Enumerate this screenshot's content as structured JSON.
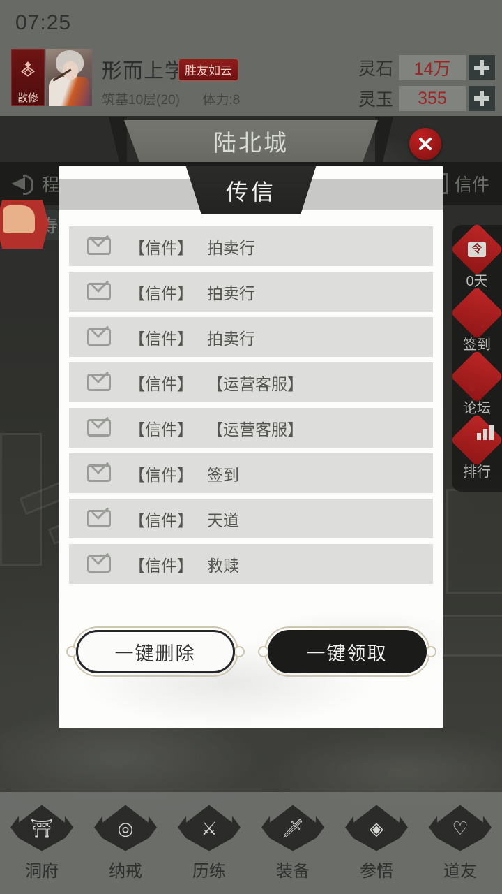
{
  "hud": {
    "clock": "07:25",
    "sect_name": "散修",
    "player_name": "形而上学",
    "guild_tag": "胜友如云",
    "realm": "筑基10层(20)",
    "stamina": "体力:8",
    "currencies": [
      {
        "label": "灵石",
        "value": "14万",
        "plus": "+"
      },
      {
        "label": "灵玉",
        "value": "355",
        "plus": "+"
      }
    ]
  },
  "city": {
    "title": "陆北城",
    "close_label": "×"
  },
  "background": {
    "toolbar_left_label": "程",
    "toolbar_right_label": "信件",
    "lifespan_label": "剩余寿元"
  },
  "side_menu": {
    "items": [
      {
        "label": "0天",
        "icon": "token-icon",
        "glyph": "令"
      },
      {
        "label": "签到",
        "icon": "check-in-icon"
      },
      {
        "label": "论坛",
        "icon": "forum-icon"
      },
      {
        "label": "排行",
        "icon": "ranking-icon"
      }
    ]
  },
  "modal": {
    "title": "传信",
    "mail_items": [
      {
        "tag": "【信件】",
        "from": "拍卖行"
      },
      {
        "tag": "【信件】",
        "from": "拍卖行"
      },
      {
        "tag": "【信件】",
        "from": "拍卖行"
      },
      {
        "tag": "【信件】",
        "from": "【运营客服】"
      },
      {
        "tag": "【信件】",
        "from": "【运营客服】"
      },
      {
        "tag": "【信件】",
        "from": "签到"
      },
      {
        "tag": "【信件】",
        "from": "天道"
      },
      {
        "tag": "【信件】",
        "from": "救赎"
      }
    ],
    "delete_all_label": "一键删除",
    "claim_all_label": "一键领取"
  },
  "bottom_nav": {
    "items": [
      {
        "label": "洞府",
        "icon": "house-icon",
        "glyph": "⛩"
      },
      {
        "label": "纳戒",
        "icon": "ring-icon",
        "glyph": "◎"
      },
      {
        "label": "历练",
        "icon": "training-icon",
        "glyph": "⚔"
      },
      {
        "label": "装备",
        "icon": "equip-icon",
        "glyph": "🗡"
      },
      {
        "label": "参悟",
        "icon": "enlighten-icon",
        "glyph": "◈"
      },
      {
        "label": "道友",
        "icon": "friends-icon",
        "glyph": "♡"
      }
    ]
  },
  "colors": {
    "accent_red": "#9b2626",
    "modal_bg": "#fdfdfc",
    "row_bg": "#dddedb",
    "dark": "#1b1c1a"
  }
}
